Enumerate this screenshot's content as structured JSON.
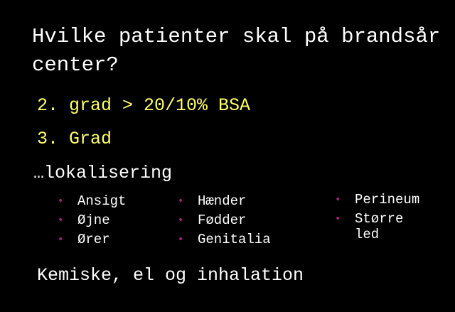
{
  "title": "Hvilke patienter skal på brandsår center?",
  "points": {
    "grade2": "2. grad > 20/10% BSA",
    "grade3": "3. Grad",
    "localisation": "…lokalisering",
    "chemical": "Kemiske, el og inhalation"
  },
  "bullet_glyph": "•",
  "bullet_color": "#a0207a",
  "accent_color": "#ffff66",
  "columns": [
    [
      "Ansigt",
      "Øjne",
      "Ører"
    ],
    [
      "Hænder",
      "Fødder",
      "Genitalia"
    ],
    [
      "Perineum",
      "Større led"
    ]
  ]
}
